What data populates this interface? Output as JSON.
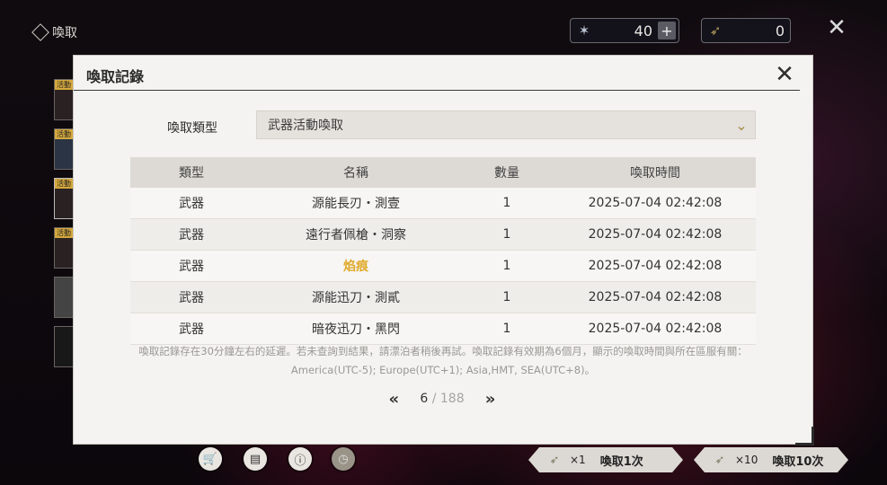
{
  "top": {
    "title": "喚取",
    "currency1_value": "40",
    "currency2_value": "0"
  },
  "sidebar_tags": [
    "活動",
    "活動",
    "活動",
    "活動"
  ],
  "modal": {
    "title": "喚取記錄",
    "type_label": "喚取類型",
    "type_selected": "武器活動喚取",
    "columns": [
      "類型",
      "名稱",
      "數量",
      "喚取時間"
    ],
    "rows": [
      {
        "type": "武器",
        "name": "源能長刃・測壹",
        "qty": "1",
        "time": "2025-07-04 02:42:08",
        "highlight": false
      },
      {
        "type": "武器",
        "name": "遠行者佩槍・洞察",
        "qty": "1",
        "time": "2025-07-04 02:42:08",
        "highlight": false
      },
      {
        "type": "武器",
        "name": "焰痕",
        "qty": "1",
        "time": "2025-07-04 02:42:08",
        "highlight": true
      },
      {
        "type": "武器",
        "name": "源能迅刀・測貳",
        "qty": "1",
        "time": "2025-07-04 02:42:08",
        "highlight": false
      },
      {
        "type": "武器",
        "name": "暗夜迅刀・黑閃",
        "qty": "1",
        "time": "2025-07-04 02:42:08",
        "highlight": false
      }
    ],
    "note_line1": "喚取記錄存在30分鐘左右的延遲。若未查詢到結果，請漂泊者稍後再試。喚取記錄有效期為6個月，顯示的喚取時間與所在區服有關：",
    "note_line2": "America(UTC-5); Europe(UTC+1); Asia,HMT, SEA(UTC+8)。",
    "page_current": "6",
    "page_total": "/ 188"
  },
  "bottom": {
    "pull1_mult": "×1",
    "pull1_label": "喚取1次",
    "pull10_mult": "×10",
    "pull10_label": "喚取10次"
  },
  "colors": {
    "highlight": "#e0a92a",
    "accent": "#a58a48"
  }
}
